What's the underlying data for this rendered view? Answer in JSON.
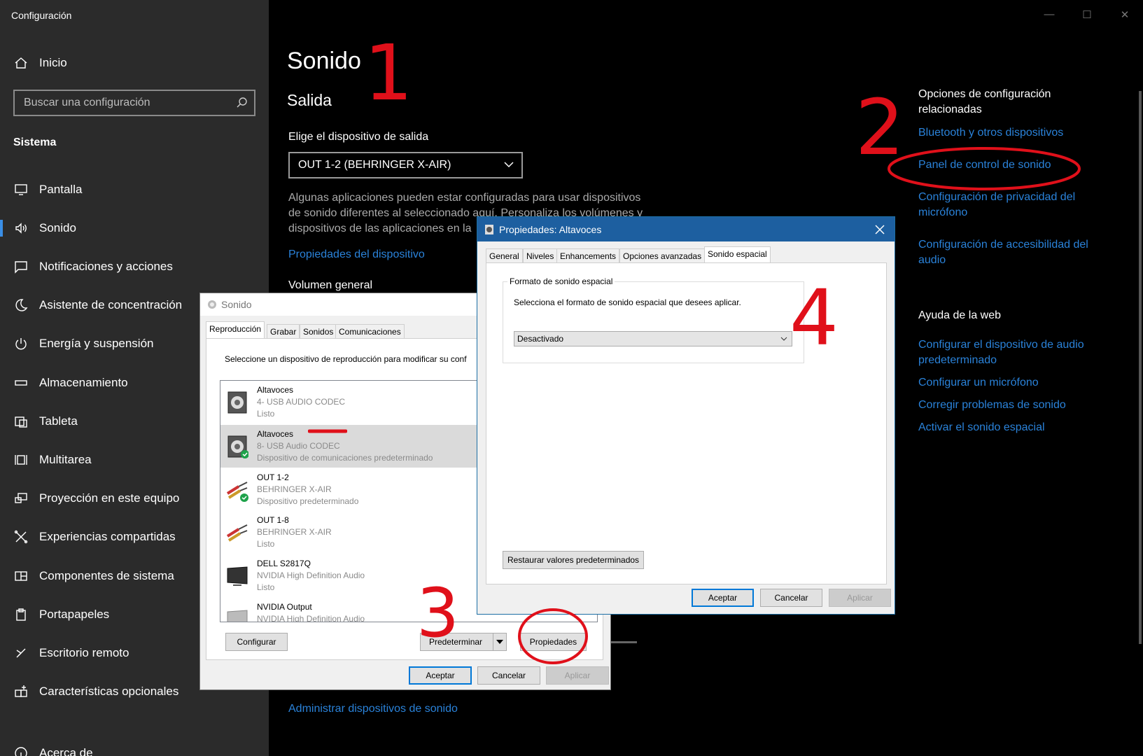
{
  "settings": {
    "app_title": "Configuración",
    "home": "Inicio",
    "search_placeholder": "Buscar una configuración",
    "section": "Sistema",
    "nav": [
      {
        "label": "Pantalla",
        "icon": "monitor-icon"
      },
      {
        "label": "Sonido",
        "icon": "speaker-icon",
        "active": true
      },
      {
        "label": "Notificaciones y acciones",
        "icon": "notification-icon"
      },
      {
        "label": "Asistente de concentración",
        "icon": "moon-icon"
      },
      {
        "label": "Energía y suspensión",
        "icon": "power-icon"
      },
      {
        "label": "Almacenamiento",
        "icon": "storage-icon"
      },
      {
        "label": "Tableta",
        "icon": "tablet-icon"
      },
      {
        "label": "Multitarea",
        "icon": "multitask-icon"
      },
      {
        "label": "Proyección en este equipo",
        "icon": "projection-icon"
      },
      {
        "label": "Experiencias compartidas",
        "icon": "shared-icon"
      },
      {
        "label": "Componentes de sistema",
        "icon": "components-icon"
      },
      {
        "label": "Portapapeles",
        "icon": "clipboard-icon"
      },
      {
        "label": "Escritorio remoto",
        "icon": "remote-icon"
      },
      {
        "label": "Características opcionales",
        "icon": "optional-icon"
      },
      {
        "label": "Acerca de",
        "icon": "info-icon"
      }
    ],
    "accent": "#2a82d9"
  },
  "main": {
    "page_title": "Sonido",
    "section_title": "Salida",
    "device_label": "Elige el dispositivo de salida",
    "device_value": "OUT 1-2 (BEHRINGER X-AIR)",
    "desc_line1": "Algunas aplicaciones pueden estar configuradas para usar dispositivos",
    "desc_line2": "de sonido diferentes al seleccionado aquí. Personaliza los volúmenes y",
    "desc_line3": "dispositivos de las aplicaciones en la",
    "device_props_link": "Propiedades del dispositivo",
    "volume_label": "Volumen general",
    "manage_link": "Administrar dispositivos de sonido"
  },
  "related": {
    "heading_line1": "Opciones de configuración",
    "heading_line2": "relacionadas",
    "link_bluetooth": "Bluetooth y otros dispositivos",
    "link_panel": "Panel de control de sonido",
    "link_privacy_1": "Configuración de privacidad del",
    "link_privacy_2": "micrófono",
    "link_access_1": "Configuración de accesibilidad del",
    "link_access_2": "audio",
    "help_heading": "Ayuda de la web",
    "help_1a": "Configurar el dispositivo de audio",
    "help_1b": "predeterminado",
    "help_2": "Configurar un micrófono",
    "help_3": "Corregir problemas de sonido",
    "help_4": "Activar el sonido espacial"
  },
  "sonido_dialog": {
    "title": "Sonido",
    "tabs": [
      "Reproducción",
      "Grabar",
      "Sonidos",
      "Comunicaciones"
    ],
    "instruction": "Seleccione un dispositivo de reproducción para modificar su conf",
    "devices": [
      {
        "name": "Altavoces",
        "sub": "4- USB AUDIO  CODEC",
        "status": "Listo",
        "icon": "speaker-device-icon"
      },
      {
        "name": "Altavoces",
        "sub": "8- USB Audio CODEC",
        "status": "Dispositivo de comunicaciones predeterminado",
        "icon": "speaker-device-icon",
        "selected": true
      },
      {
        "name": "OUT 1-2",
        "sub": "BEHRINGER X-AIR",
        "status": "Dispositivo predeterminado",
        "icon": "rca-cable-icon"
      },
      {
        "name": "OUT 1-8",
        "sub": "BEHRINGER X-AIR",
        "status": "Listo",
        "icon": "rca-cable-icon"
      },
      {
        "name": "DELL S2817Q",
        "sub": "NVIDIA High Definition Audio",
        "status": "Listo",
        "icon": "monitor-device-icon"
      },
      {
        "name": "NVIDIA Output",
        "sub": "NVIDIA High Definition Audio",
        "status": "",
        "icon": "monitor-device-icon"
      }
    ],
    "btn_configure": "Configurar",
    "btn_default": "Predeterminar",
    "btn_properties": "Propiedades",
    "btn_ok": "Aceptar",
    "btn_cancel": "Cancelar",
    "btn_apply": "Aplicar"
  },
  "prop_dialog": {
    "title": "Propiedades: Altavoces",
    "tabs": [
      "General",
      "Niveles",
      "Enhancements",
      "Opciones avanzadas",
      "Sonido espacial"
    ],
    "group_label": "Formato de sonido espacial",
    "group_text": "Selecciona el formato de sonido espacial que desees aplicar.",
    "format_value": "Desactivado",
    "btn_restore": "Restaurar valores predeterminados",
    "btn_ok": "Aceptar",
    "btn_cancel": "Cancelar",
    "btn_apply": "Aplicar",
    "title_color": "#1d5fa0"
  },
  "annotations": {
    "n1": "1",
    "n2": "2",
    "n3": "3",
    "n4": "4",
    "color": "#e0101a"
  }
}
